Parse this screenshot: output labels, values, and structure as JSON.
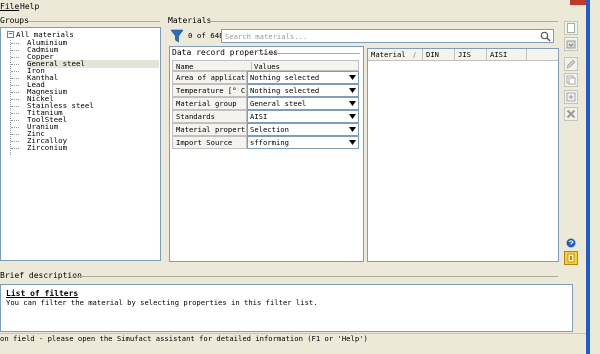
{
  "menu": {
    "file": "File",
    "help": "Help"
  },
  "groups": {
    "title": "Groups",
    "root": "All materials",
    "items": [
      "Aluminium",
      "Cadmium",
      "Copper",
      "General steel",
      "Iron",
      "Kanthal",
      "Lead",
      "Magnesium",
      "Nickel",
      "Stainless steel",
      "Titanium",
      "ToolSteel",
      "Uranium",
      "Zinc",
      "Zircalloy",
      "Zirconium"
    ],
    "selected": "General steel",
    "expander": "−"
  },
  "materials": {
    "title": "Materials",
    "count": "0 of 648",
    "search_placeholder": "Search materials..."
  },
  "data_record": {
    "title": "Data record properties",
    "col_name": "Name",
    "col_values": "Values",
    "rows": [
      {
        "name": "Area of application",
        "value": "Nothing selected"
      },
      {
        "name": "Temperature [° C]",
        "value": "Nothing selected"
      },
      {
        "name": "Material group",
        "value": "General steel"
      },
      {
        "name": "Standards",
        "value": "AISI"
      },
      {
        "name": "Material properties",
        "value": "Selection"
      },
      {
        "name": "Import Source",
        "value": "sfforming"
      }
    ]
  },
  "results_table": {
    "columns": [
      "Material",
      "DIN",
      "JIS",
      "AISI"
    ]
  },
  "brief": {
    "title": "Brief description",
    "heading": "List of filters",
    "text": "You can filter the material by selecting properties in this filter list."
  },
  "status_text": "on field - please open the Simufact assistant for detailed information (F1 or 'Help')",
  "colors": {
    "background": "#ece9d8",
    "border": "#7f9db9",
    "filter_icon": "#2a6fb8",
    "delete_icon": "#9a9a9a"
  },
  "icons": {
    "filter": "filter-icon",
    "search": "search-icon",
    "help": "help-icon",
    "info": "info-icon"
  }
}
